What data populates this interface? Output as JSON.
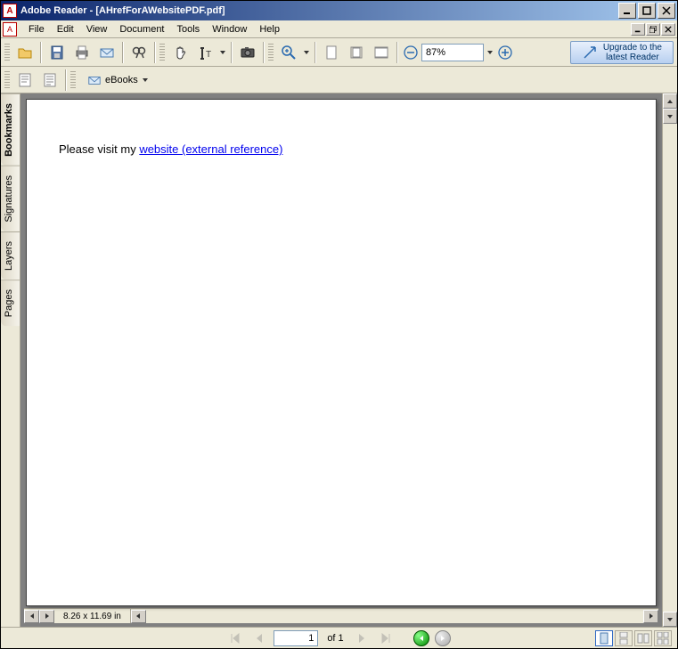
{
  "title": "Adobe Reader - [AHrefForAWebsitePDF.pdf]",
  "menus": [
    "File",
    "Edit",
    "View",
    "Document",
    "Tools",
    "Window",
    "Help"
  ],
  "zoom": "87%",
  "upgrade": {
    "line1": "Upgrade to the",
    "line2": "latest Reader"
  },
  "ebooks_label": "eBooks",
  "side_tabs": [
    "Bookmarks",
    "Signatures",
    "Layers",
    "Pages"
  ],
  "document": {
    "prefix": "Please visit my ",
    "link_text": "website (external reference)"
  },
  "page_size": "8.26 x 11.69 in",
  "page_current": "1",
  "page_of": "of 1"
}
